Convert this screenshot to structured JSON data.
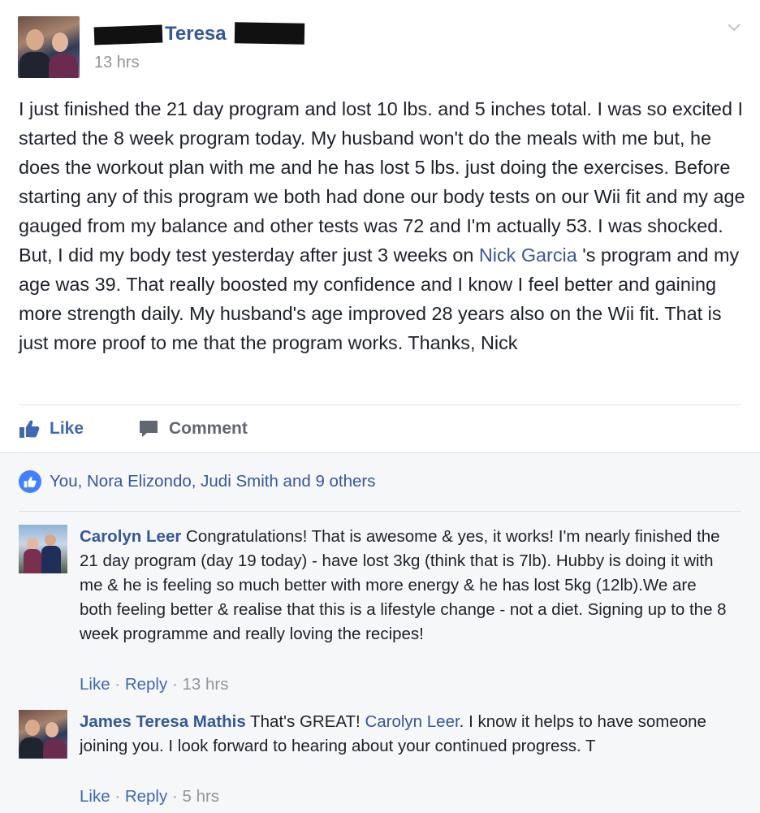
{
  "post": {
    "author_name": "Teresa",
    "timestamp": "13 hrs",
    "text_parts": [
      "I just finished the 21 day program and lost 10 lbs. and 5 inches total. I was so excited I started the 8 week program today. My husband won't do the meals with me but, he does the workout plan with me and he has lost 5 lbs. just doing the exercises. Before starting any of this program we both had done our body tests on our Wii fit and my age gauged from my balance and other tests was 72 and I'm actually 53. I was shocked. But, I did my body test yesterday after just 3 weeks on ",
      "Nick Garcia",
      " 's program and my age was 39. That really boosted my confidence and I know I feel better and gaining more strength daily. My husband's age improved 28 years also on the Wii fit. That is just more proof to me that the program works. Thanks, Nick"
    ],
    "actions": {
      "like": "Like",
      "comment": "Comment"
    }
  },
  "reactions": {
    "text": "You, Nora Elizondo, Judi Smith and 9 others"
  },
  "comments": [
    {
      "author": "Carolyn Leer",
      "text": " Congratulations! That is awesome & yes, it works! I'm nearly finished the 21 day program (day 19 today) - have lost 3kg (think that is 7lb). Hubby is doing it with me & he is feeling so much better with more energy & he has lost 5kg (12lb).We are both feeling better & realise that this is a lifestyle change - not a diet. Signing up to the 8 week programme and really loving the recipes!",
      "like": "Like",
      "reply": "Reply",
      "sep": " · ",
      "time": "13 hrs"
    },
    {
      "author": "James Teresa Mathis",
      "text_a": " That's GREAT! ",
      "mention": "Carolyn Leer",
      "text_b": ". I know it helps to have someone joining you. I look forward to hearing about your continued progress. T",
      "like": "Like",
      "reply": "Reply",
      "sep": " · ",
      "time": "5 hrs"
    }
  ],
  "colors": {
    "link": "#365899",
    "like_blue": "#4267b2",
    "meta_gray": "#90949c",
    "badge_blue": "#4080ff"
  }
}
